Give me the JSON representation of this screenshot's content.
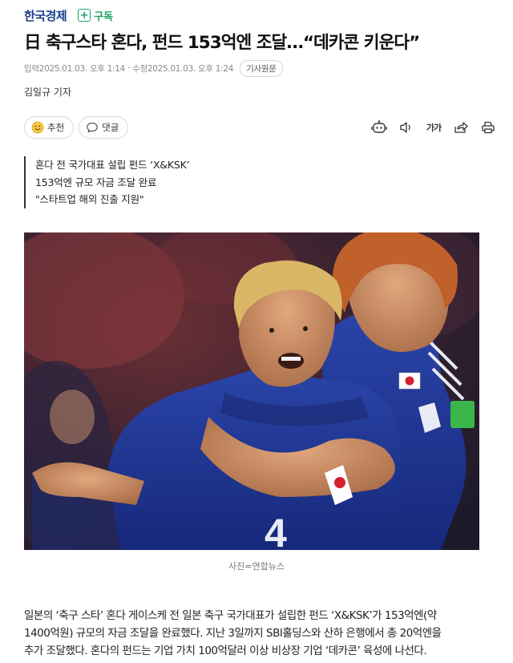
{
  "brand": "한국경제",
  "subscribe_label": "구독",
  "headline": "日 축구스타 혼다, 펀드 153억엔 조달…“데카콘 키운다”",
  "dates": {
    "input": "입력2025.01.03. 오후 1:14",
    "modified": "수정2025.01.03. 오후 1:24",
    "source_button": "기사원문"
  },
  "byline": "김일규 기자",
  "actions": {
    "recommend_label": "추천",
    "comment_label": "댓글"
  },
  "tools": {
    "font_size_label": "가가",
    "icons": [
      "robot-summary-icon",
      "speaker-icon",
      "font-size-icon",
      "share-icon",
      "print-icon"
    ]
  },
  "summary": [
    "혼다 전 국가대표 설립 펀드 ‘X&KSK’",
    "153억엔 규모 자금 조달 완료",
    "\"스타트업 해외 진출 지원\""
  ],
  "photo": {
    "caption": "사진=연합뉴스",
    "jersey_number": "4"
  },
  "body_lines": [
    "일본의 ‘축구 스타’ 혼다 게이스케 전 일본 축구 국가대표가 설립한 펀드 ‘X&KSK’가 153억엔(약",
    "1400억원) 규모의 자금 조달을 완료했다. 지난 3일까지 SBI홀딩스와 산하 은행에서 총 20억엔을",
    "추가 조달했다. 혼다의 펀드는 기업 가치 100억달러 이상 비상장 기업 ‘데카콘’ 육성에 나선다."
  ],
  "colors": {
    "brand": "#1a3c8c",
    "subscribe": "#19a56a",
    "jersey": "#1b2f8a"
  }
}
